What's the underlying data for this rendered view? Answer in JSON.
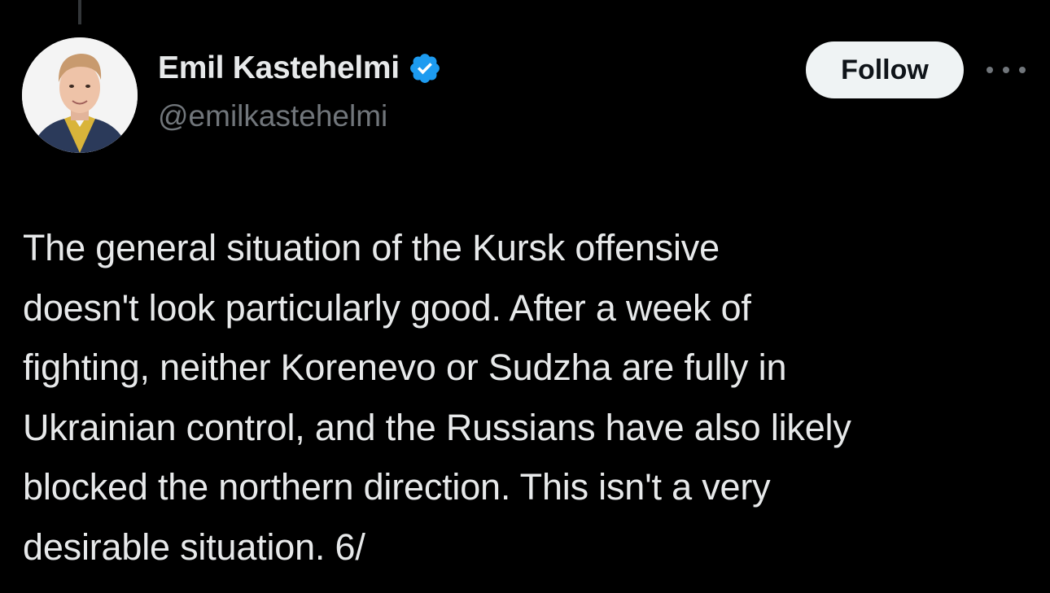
{
  "author": {
    "display_name": "Emil Kastehelmi",
    "handle": "@emilkastehelmi",
    "verified": true,
    "verified_color": "#1d9bf0"
  },
  "actions": {
    "follow_label": "Follow",
    "more_icon": "more-horizontal-icon"
  },
  "tweet": {
    "lines": [
      "The general situation of the Kursk offensive",
      "doesn't look particularly good. After a week of",
      "fighting, neither Korenevo or Sudzha are fully in",
      "Ukrainian control, and the Russians have also likely",
      "blocked the northern direction. This isn't a very",
      "desirable situation. 6/"
    ]
  },
  "theme": {
    "background": "#000000",
    "text": "#e7e9ea",
    "secondary_text": "#71767b",
    "button_bg": "#eff3f4"
  }
}
